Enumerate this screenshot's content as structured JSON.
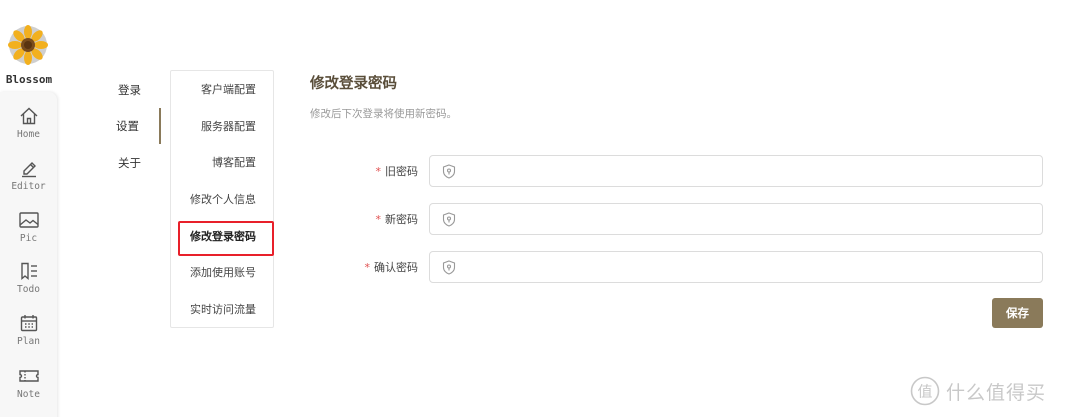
{
  "app": {
    "name": "Blossom"
  },
  "rail": {
    "items": [
      {
        "label": "Home",
        "icon": "home-icon"
      },
      {
        "label": "Editor",
        "icon": "editor-icon"
      },
      {
        "label": "Pic",
        "icon": "picture-icon"
      },
      {
        "label": "Todo",
        "icon": "todo-icon"
      },
      {
        "label": "Plan",
        "icon": "calendar-icon"
      },
      {
        "label": "Note",
        "icon": "ticket-icon"
      }
    ]
  },
  "sections": {
    "items": [
      "登录",
      "设置",
      "关于"
    ],
    "active": "设置"
  },
  "subnav": {
    "items": [
      "客户端配置",
      "服务器配置",
      "博客配置",
      "修改个人信息",
      "修改登录密码",
      "添加使用账号",
      "实时访问流量"
    ],
    "active": "修改登录密码"
  },
  "main": {
    "title": "修改登录密码",
    "description": "修改后下次登录将使用新密码。",
    "fields": [
      {
        "label": "旧密码",
        "required_mark": "*",
        "value": "",
        "icon": "shield-lock-icon"
      },
      {
        "label": "新密码",
        "required_mark": "*",
        "value": "",
        "icon": "shield-lock-icon"
      },
      {
        "label": "确认密码",
        "required_mark": "*",
        "value": "",
        "icon": "shield-lock-icon"
      }
    ],
    "save_label": "保存"
  },
  "watermark": {
    "text": "什么值得买",
    "logo": "zhi-logo"
  },
  "colors": {
    "accent": "#8a7a5a",
    "highlight": "#e8202a",
    "required": "#e05050"
  }
}
